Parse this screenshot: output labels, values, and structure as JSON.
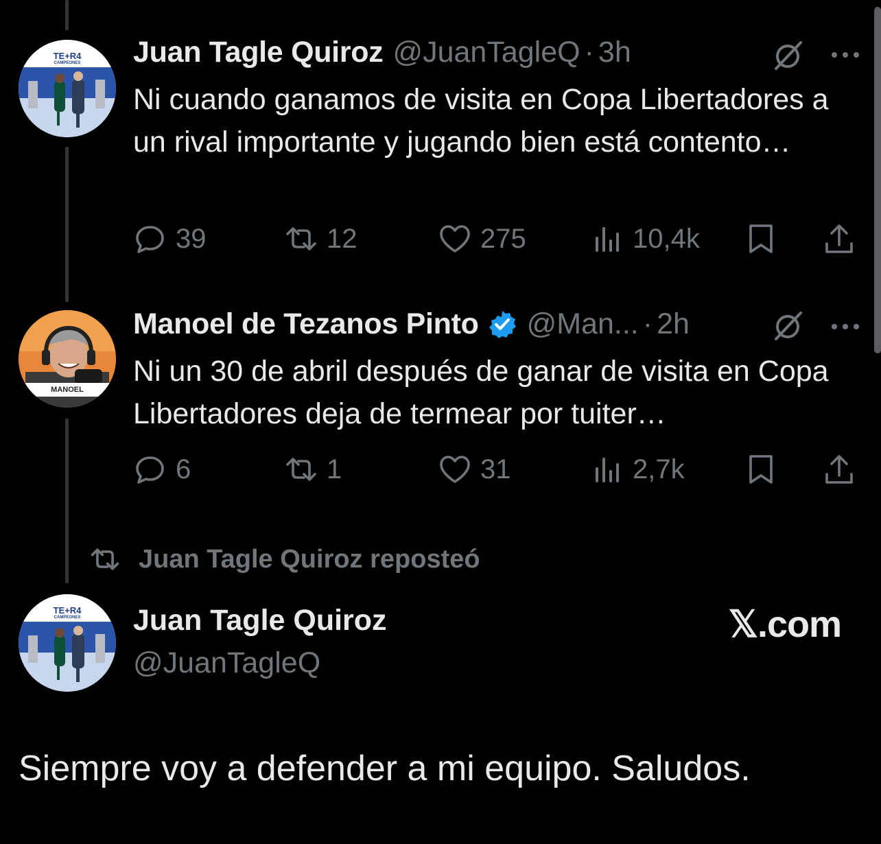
{
  "tweets": [
    {
      "name": "Juan Tagle Quiroz",
      "handle": "@JuanTagleQ",
      "time": "3h",
      "verified": false,
      "text": "Ni cuando ganamos de visita en Copa Libertadores a un rival importante y jugando bien está contento…",
      "replies": "39",
      "reposts": "12",
      "likes": "275",
      "views": "10,4k",
      "avatar_banner": "TE+R4",
      "avatar_subtitle": "CAMPEONES"
    },
    {
      "name": "Manoel de Tezanos Pinto",
      "handle": "@Man...",
      "time": "2h",
      "verified": true,
      "text": "Ni un 30 de abril después de ganar de visita en Copa Libertadores deja de termear por tuiter…",
      "replies": "6",
      "reposts": "1",
      "likes": "31",
      "views": "2,7k",
      "avatar_caption": "MANOEL"
    }
  ],
  "repost_label": "Juan Tagle Quiroz reposteó",
  "quoted": {
    "name": "Juan Tagle Quiroz",
    "handle": "@JuanTagleQ",
    "text": "Siempre voy a defender a mi equipo. Saludos.",
    "avatar_banner": "TE+R4",
    "avatar_subtitle": "CAMPEONES"
  },
  "watermark": "𝕏.com",
  "separator": "·",
  "colors": {
    "background": "#000000",
    "text": "#e7e9ea",
    "secondary": "#71767b",
    "verified": "#1d9bf0",
    "thread_line": "#333639"
  },
  "icons": [
    "grok-icon",
    "more-icon",
    "reply-icon",
    "repost-icon",
    "like-icon",
    "views-icon",
    "bookmark-icon",
    "share-icon",
    "verified-badge-icon"
  ]
}
